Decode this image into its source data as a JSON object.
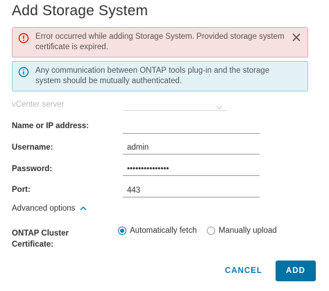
{
  "dialog": {
    "title": "Add Storage System"
  },
  "alerts": {
    "error": {
      "message": "Error occurred while adding Storage System. Provided storage system certificate is expired.",
      "icon": "error-circle-icon",
      "close_icon": "close-icon",
      "color": "#c92100"
    },
    "info": {
      "message": "Any communication between ONTAP tools plug-in and the storage system should be mutually authenticated.",
      "icon": "info-circle-icon",
      "color": "#0079b8"
    }
  },
  "form": {
    "vcenter": {
      "label": "vCenter server",
      "value": ""
    },
    "name": {
      "label": "Name or IP address:",
      "value": ""
    },
    "username": {
      "label": "Username:",
      "value": "admin"
    },
    "password": {
      "label": "Password:",
      "value": "•••••••••••••••"
    },
    "port": {
      "label": "Port:",
      "value": "443"
    },
    "advanced": {
      "label": "Advanced options",
      "icon": "chevron-up-icon"
    },
    "certificate": {
      "label_line1": "ONTAP Cluster",
      "label_line2": "Certificate:",
      "options": [
        "Automatically fetch",
        "Manually upload"
      ],
      "selected": "Automatically fetch"
    }
  },
  "actions": {
    "cancel": "CANCEL",
    "add": "ADD"
  },
  "colors": {
    "accent": "#0079b8",
    "primary_button": "#0072a3"
  }
}
